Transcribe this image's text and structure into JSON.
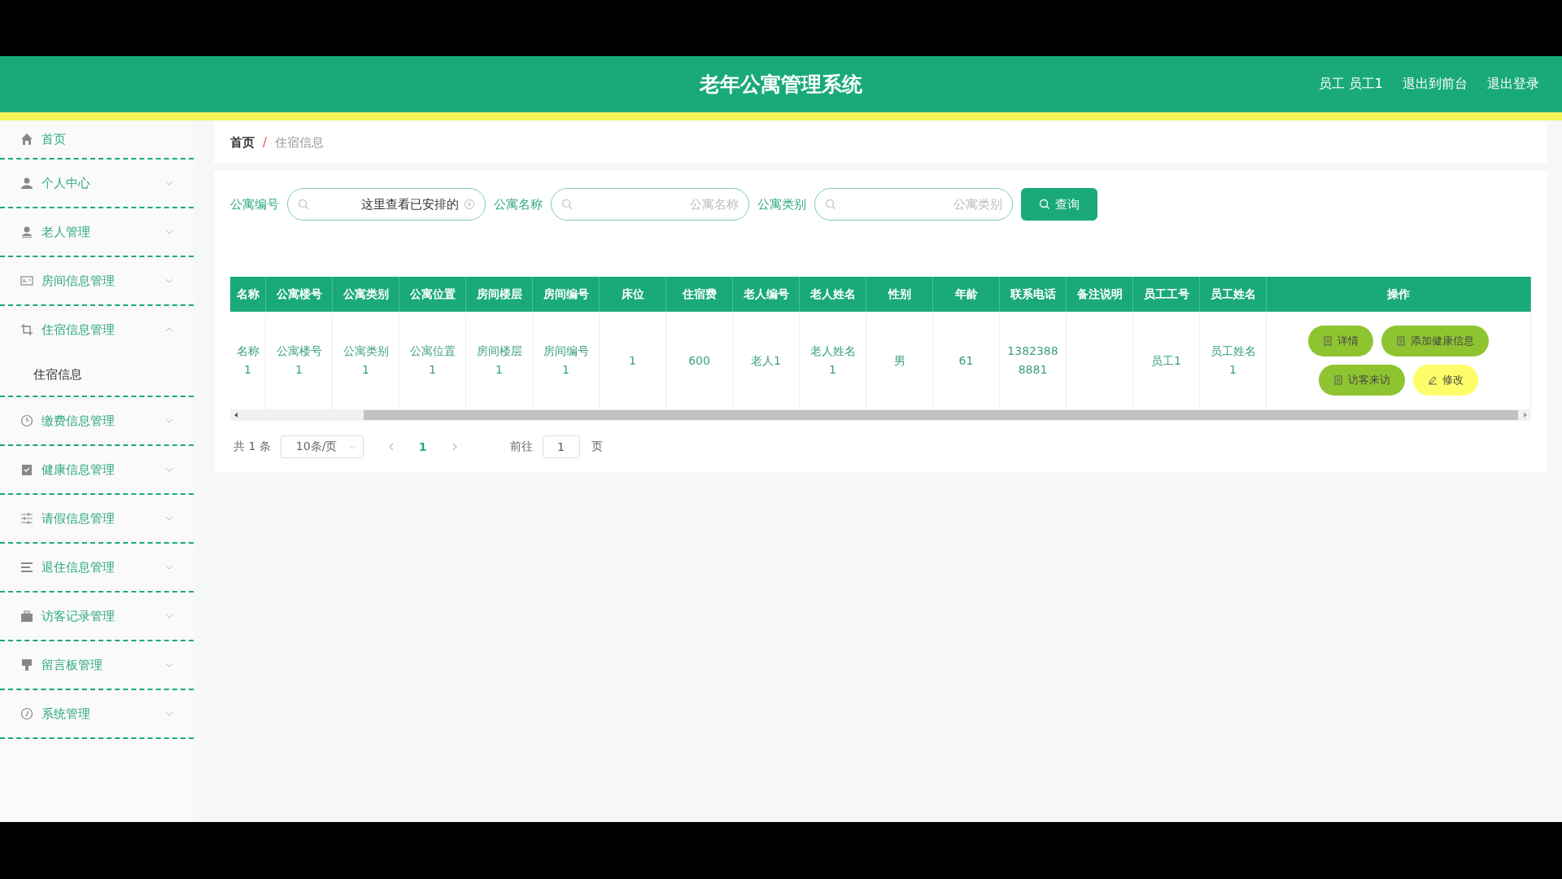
{
  "header": {
    "title": "老年公寓管理系统",
    "links": [
      "员工 员工1",
      "退出到前台",
      "退出登录"
    ]
  },
  "sidebar": {
    "items": [
      {
        "label": "首页",
        "kind": "link"
      },
      {
        "label": "个人中心",
        "kind": "menu",
        "expanded": false
      },
      {
        "label": "老人管理",
        "kind": "menu",
        "expanded": false
      },
      {
        "label": "房间信息管理",
        "kind": "menu",
        "expanded": false
      },
      {
        "label": "住宿信息管理",
        "kind": "menu",
        "expanded": true,
        "children": [
          {
            "label": "住宿信息"
          }
        ]
      },
      {
        "label": "缴费信息管理",
        "kind": "menu",
        "expanded": false
      },
      {
        "label": "健康信息管理",
        "kind": "menu",
        "expanded": false
      },
      {
        "label": "请假信息管理",
        "kind": "menu",
        "expanded": false
      },
      {
        "label": "退住信息管理",
        "kind": "menu",
        "expanded": false
      },
      {
        "label": "访客记录管理",
        "kind": "menu",
        "expanded": false
      },
      {
        "label": "留言板管理",
        "kind": "menu",
        "expanded": false
      },
      {
        "label": "系统管理",
        "kind": "menu",
        "expanded": false
      }
    ]
  },
  "breadcrumb": {
    "separator": "/",
    "items": [
      "首页",
      "住宿信息"
    ]
  },
  "search": {
    "fields": [
      {
        "label": "公寓编号",
        "value": "这里查看已安排的"
      },
      {
        "label": "公寓名称",
        "placeholder": "公寓名称"
      },
      {
        "label": "公寓类别",
        "placeholder": "公寓类别"
      }
    ],
    "button": "查询"
  },
  "table": {
    "columns": [
      "名称",
      "公寓楼号",
      "公寓类别",
      "公寓位置",
      "房间楼层",
      "房间编号",
      "床位",
      "住宿费",
      "老人编号",
      "老人姓名",
      "性别",
      "年龄",
      "联系电话",
      "备注说明",
      "员工工号",
      "员工姓名",
      "操作"
    ],
    "rows": [
      {
        "cells": [
          "名称1",
          "公寓楼号1",
          "公寓类别1",
          "公寓位置1",
          "房间楼层1",
          "房间编号1",
          "1",
          "600",
          "老人1",
          "老人姓名1",
          "男",
          "61",
          "13823888881",
          "",
          "员工1",
          "员工姓名1"
        ],
        "actions": [
          {
            "label": "详情",
            "kind": "primary"
          },
          {
            "label": "添加健康信息",
            "kind": "primary"
          },
          {
            "label": "访客来访",
            "kind": "primary"
          },
          {
            "label": "修改",
            "kind": "warning"
          }
        ]
      }
    ]
  },
  "pagination": {
    "total": "共 1 条",
    "page_size": "10条/页",
    "pages": [
      {
        "label": "1",
        "selected": true
      }
    ],
    "goto_label": "前往",
    "goto_value": "1",
    "goto_unit": "页"
  }
}
